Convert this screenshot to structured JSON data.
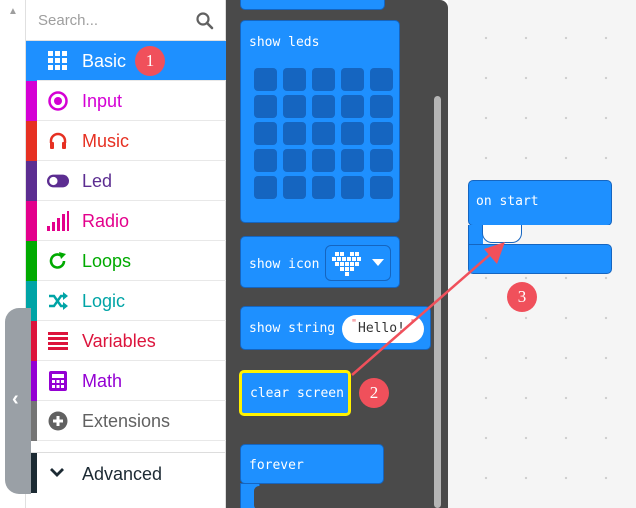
{
  "search": {
    "placeholder": "Search..."
  },
  "categories": [
    {
      "label": "Basic",
      "color": "#1e90ff",
      "icon": "grid-icon"
    },
    {
      "label": "Input",
      "color": "#d400d4",
      "icon": "input-circle-icon"
    },
    {
      "label": "Music",
      "color": "#e63022",
      "icon": "headphones-icon"
    },
    {
      "label": "Led",
      "color": "#5c2d91",
      "icon": "toggle-icon"
    },
    {
      "label": "Radio",
      "color": "#e3008c",
      "icon": "signal-bars-icon"
    },
    {
      "label": "Loops",
      "color": "#00aa00",
      "icon": "loop-arrow-icon"
    },
    {
      "label": "Logic",
      "color": "#00a4a6",
      "icon": "shuffle-icon"
    },
    {
      "label": "Variables",
      "color": "#dc143c",
      "icon": "list-lines-icon"
    },
    {
      "label": "Math",
      "color": "#9400d3",
      "icon": "calculator-icon"
    },
    {
      "label": "Extensions",
      "color": "#757575",
      "icon": "plus-circle-icon"
    }
  ],
  "advanced": {
    "label": "Advanced"
  },
  "blocks": {
    "show_leds": "show leds",
    "show_icon": "show icon",
    "show_string": "show string",
    "string_value": "Hello!",
    "clear_screen": "clear screen",
    "forever": "forever",
    "on_start": "on start"
  },
  "annotations": {
    "badge1": "1",
    "badge2": "2",
    "badge3": "3"
  },
  "colors": {
    "accent": "#1e90ff",
    "annotation": "#f0505b",
    "highlight": "#fff200"
  }
}
